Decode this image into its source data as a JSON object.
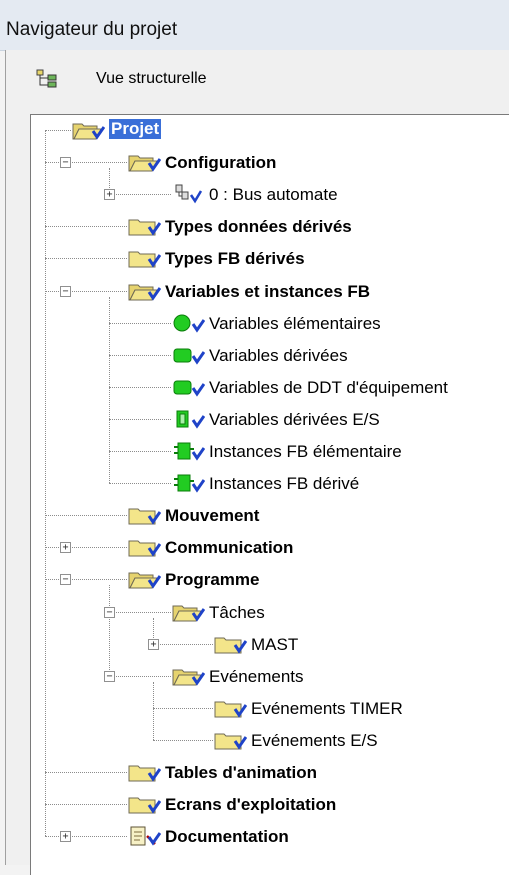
{
  "window": {
    "title": "Navigateur du projet"
  },
  "toolbar": {
    "view_label": "Vue structurelle",
    "view_icon": "structure-view-icon"
  },
  "tree": {
    "nodes": [
      {
        "label": "Projet",
        "bold": true,
        "selected": true,
        "icon": "folder-open-icon"
      },
      {
        "label": "Configuration",
        "bold": true,
        "expander": "−",
        "icon": "folder-open-icon"
      },
      {
        "label": "0 : Bus automate",
        "bold": false,
        "expander": "+",
        "icon": "bus-icon"
      },
      {
        "label": "Types données dérivés",
        "bold": true,
        "icon": "folder-icon"
      },
      {
        "label": "Types FB dérivés",
        "bold": true,
        "icon": "folder-icon"
      },
      {
        "label": "Variables et instances FB",
        "bold": true,
        "expander": "−",
        "icon": "folder-open-icon"
      },
      {
        "label": "Variables élémentaires",
        "bold": false,
        "icon": "elementary-variable-icon"
      },
      {
        "label": "Variables dérivées",
        "bold": false,
        "icon": "derived-variable-icon"
      },
      {
        "label": "Variables de DDT d'équipement",
        "bold": false,
        "icon": "device-ddt-variable-icon"
      },
      {
        "label": "Variables dérivées E/S",
        "bold": false,
        "icon": "io-derived-variable-icon"
      },
      {
        "label": "Instances FB élémentaire",
        "bold": false,
        "icon": "fb-instance-icon"
      },
      {
        "label": "Instances FB dérivé",
        "bold": false,
        "icon": "derived-fb-instance-icon"
      },
      {
        "label": "Mouvement",
        "bold": true,
        "icon": "folder-icon"
      },
      {
        "label": "Communication",
        "bold": true,
        "expander": "+",
        "icon": "folder-icon"
      },
      {
        "label": "Programme",
        "bold": true,
        "expander": "−",
        "icon": "folder-open-icon"
      },
      {
        "label": "Tâches",
        "bold": false,
        "expander": "−",
        "icon": "folder-open-icon"
      },
      {
        "label": "MAST",
        "bold": false,
        "expander": "+",
        "icon": "folder-icon"
      },
      {
        "label": "Evénements",
        "bold": false,
        "expander": "−",
        "icon": "folder-open-icon"
      },
      {
        "label": "Evénements TIMER",
        "bold": false,
        "icon": "folder-icon"
      },
      {
        "label": "Evénements E/S",
        "bold": false,
        "icon": "folder-icon"
      },
      {
        "label": "Tables d'animation",
        "bold": true,
        "icon": "folder-icon"
      },
      {
        "label": "Ecrans d'exploitation",
        "bold": true,
        "icon": "folder-icon"
      },
      {
        "label": "Documentation",
        "bold": true,
        "expander": "+",
        "icon": "documentation-icon"
      }
    ]
  },
  "colors": {
    "folder": "#f3e58a",
    "check": "#1f43c8",
    "green": "#22cc22",
    "selection": "#3a6fd8"
  }
}
